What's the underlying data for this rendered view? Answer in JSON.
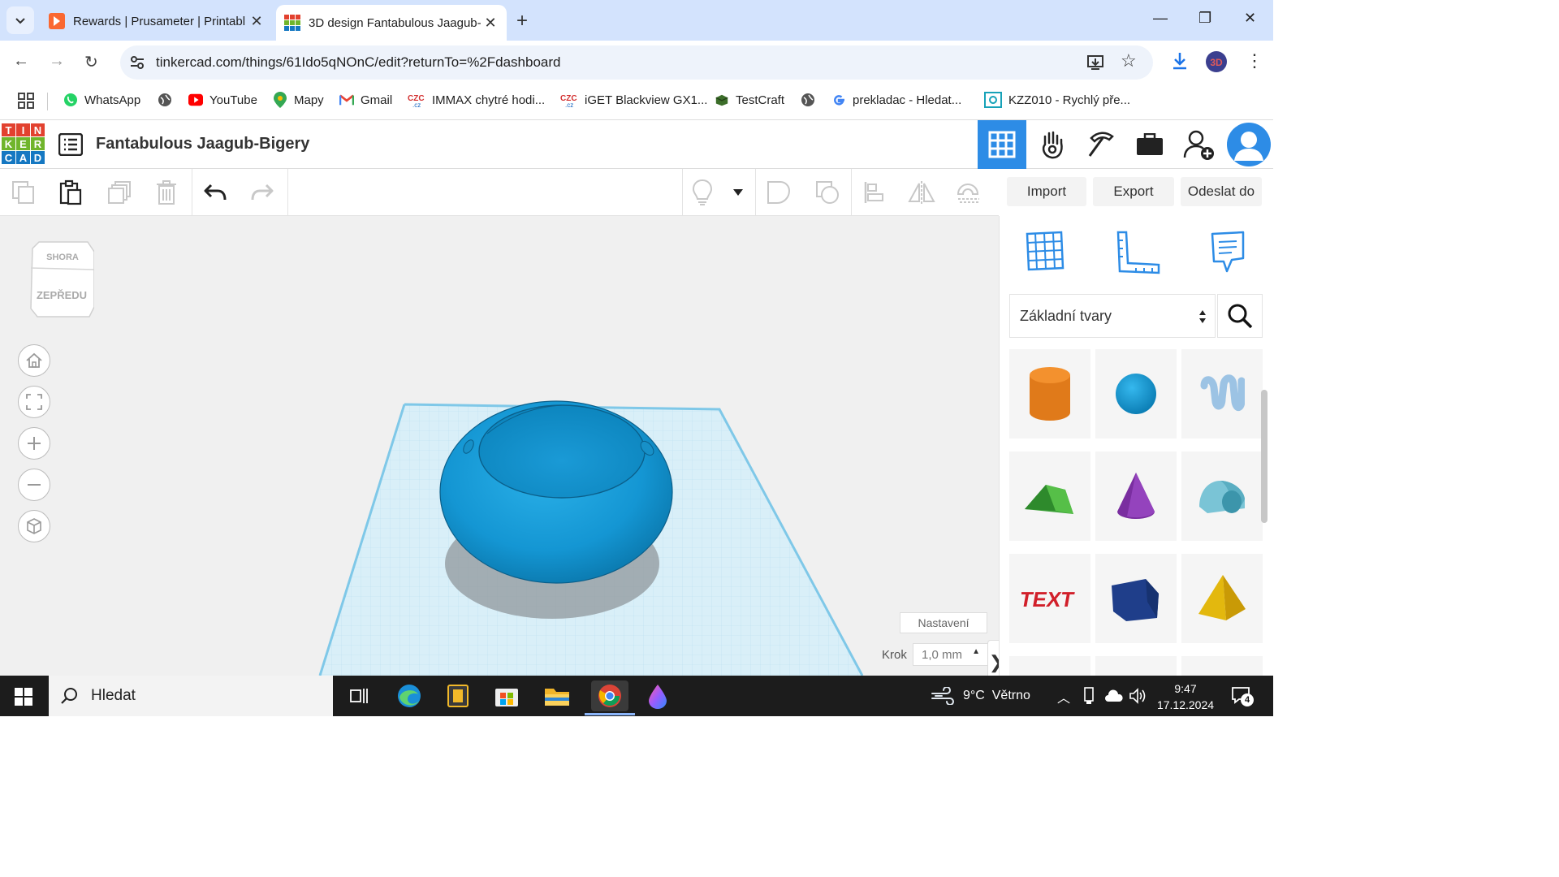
{
  "browser": {
    "tabs": [
      {
        "title": "Rewards | Prusameter | Printabl",
        "active": false
      },
      {
        "title": "3D design Fantabulous Jaagub-",
        "active": true
      }
    ],
    "url": "tinkercad.com/things/61Ido5qNOnC/edit?returnTo=%2Fdashboard",
    "bookmarks": [
      "WhatsApp",
      "",
      "YouTube",
      "Mapy",
      "Gmail",
      "IMMAX chytré hodi...",
      "iGET Blackview GX1...",
      "TestCraft",
      "",
      "prekladac - Hledat...",
      "KZZ010 - Rychlý pře..."
    ],
    "colors": {
      "tabstrip": "#d3e3fd",
      "omnibox": "#eef3fb"
    }
  },
  "tinkercad": {
    "logo_letters": [
      "T",
      "I",
      "N",
      "K",
      "E",
      "R",
      "C",
      "A",
      "D"
    ],
    "design_title": "Fantabulous Jaagub-Bigery",
    "actions": {
      "import": "Import",
      "export": "Export",
      "send": "Odeslat do"
    },
    "view_cube": {
      "top": "SHORA",
      "front": "ZEPŘEDU"
    },
    "settings_label": "Nastavení",
    "step_label": "Krok",
    "step_value": "1,0 mm",
    "shape_category": "Základní tvary",
    "shapes": [
      "cylinder-shape",
      "sphere-shape",
      "scribble-shape",
      "roof-shape",
      "cone-shape",
      "round-roof-shape",
      "text-shape",
      "polygon-shape",
      "pyramid-shape"
    ],
    "colors": {
      "accent": "#2d8ce6",
      "object": "#1a9ad6"
    }
  },
  "taskbar": {
    "search_label": "Hledat",
    "weather": "9°C  Větrno",
    "time": "9:47",
    "date": "17.12.2024",
    "notifications": "4"
  }
}
